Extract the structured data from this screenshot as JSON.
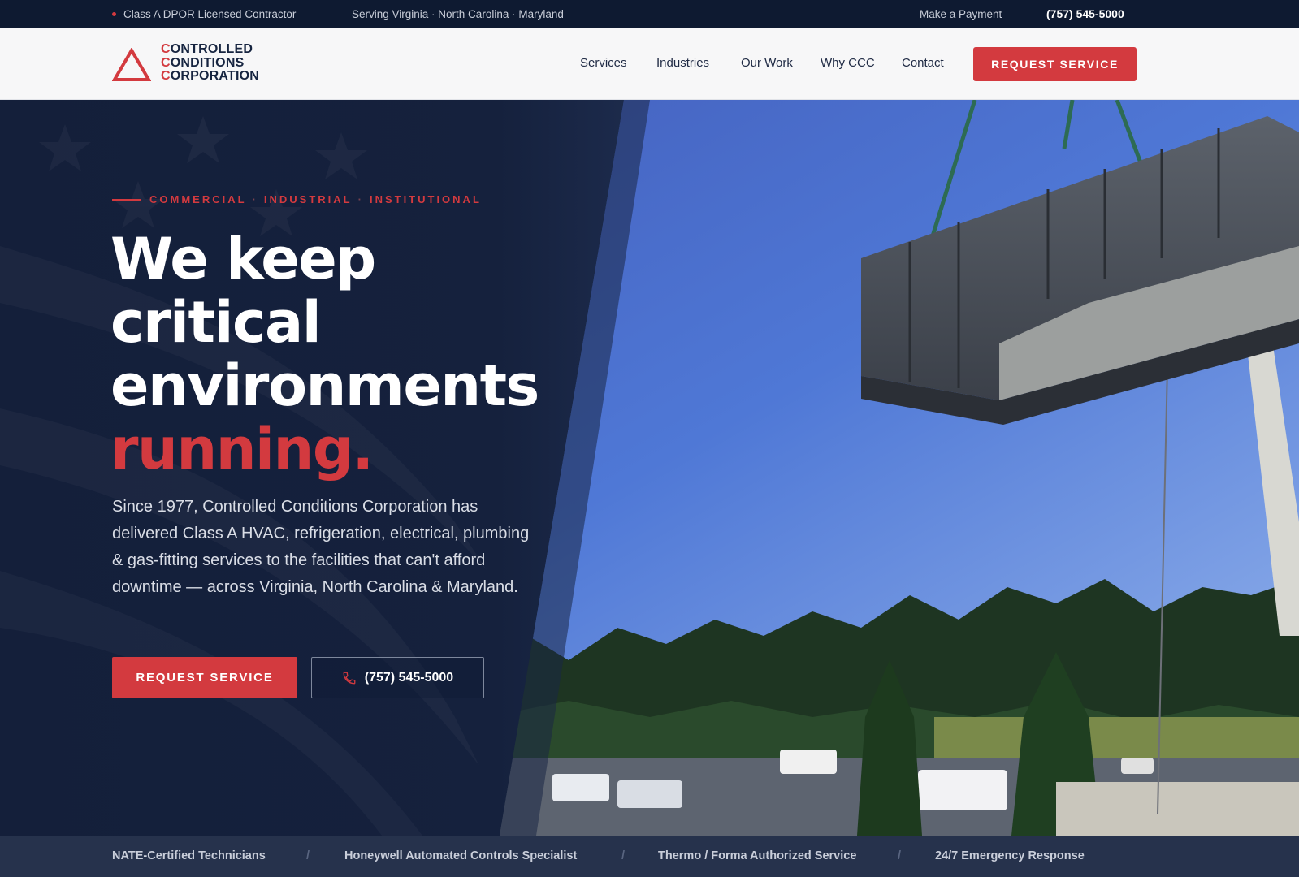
{
  "topbar": {
    "license": "Class A DPOR Licensed Contractor",
    "serving": "Serving Virginia · North Carolina · Maryland",
    "payment": "Make a Payment",
    "phone": "(757) 545-5000"
  },
  "logo": {
    "lines": [
      {
        "cap": "C",
        "rest": "ONTROLLED"
      },
      {
        "cap": "C",
        "rest": "ONDITIONS"
      },
      {
        "cap": "C",
        "rest": "ORPORATION"
      }
    ]
  },
  "nav": {
    "services": "Services",
    "industries": "Industries",
    "our_work": "Our Work",
    "why": "Why CCC",
    "contact": "Contact",
    "cta": "REQUEST SERVICE"
  },
  "hero": {
    "eyebrow": [
      "COMMERCIAL",
      "INDUSTRIAL",
      "INSTITUTIONAL"
    ],
    "eyebrow_sep": "·",
    "headline": [
      "We keep",
      "critical",
      "environments"
    ],
    "headline_accent": "running.",
    "lede": "Since 1977, Controlled Conditions Corporation has delivered Class A HVAC, refrigeration, electrical, plumbing & gas-fitting services to the facilities that can't afford downtime — across Virginia, North Carolina & Maryland.",
    "cta_primary": "REQUEST SERVICE",
    "cta_phone": "(757) 545-5000"
  },
  "trust_strip": {
    "items": [
      "NATE-Certified Technicians",
      "Honeywell Automated Controls Specialist",
      "Thermo / Forma Authorized Service",
      "24/7 Emergency Response"
    ],
    "sep": "/"
  },
  "colors": {
    "brand_red": "#d33a3f",
    "navy": "#0f1b33",
    "header_bg": "#f7f7f8"
  }
}
